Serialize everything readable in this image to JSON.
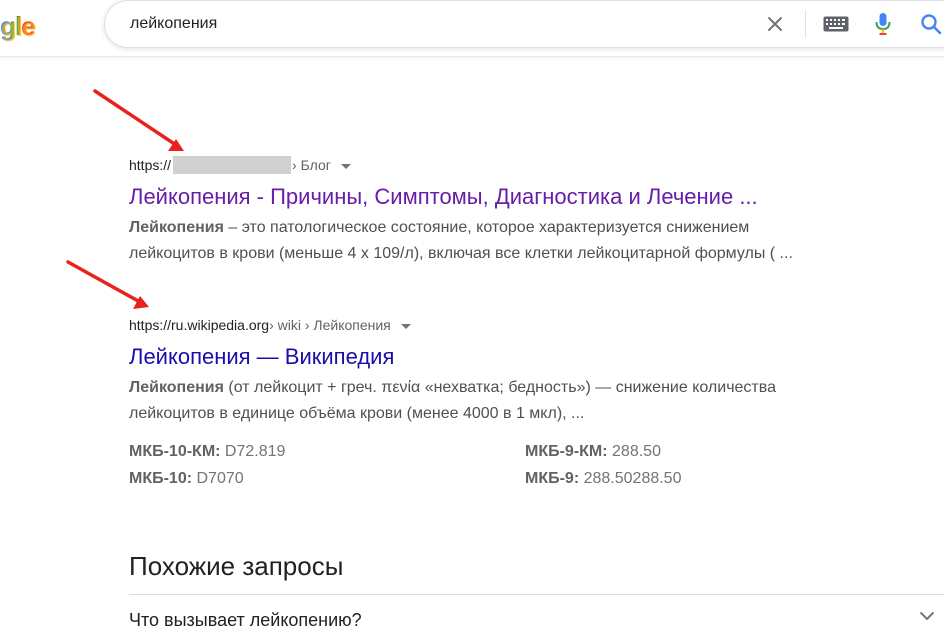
{
  "header": {
    "logo_fragment": "gle",
    "search": {
      "value": "лейкопения",
      "placeholder": ""
    }
  },
  "results": [
    {
      "url_prefix": "https://",
      "url_path": " › Блог",
      "title": "Лейкопения - Причины, Симптомы, Диагностика и Лечение ...",
      "snippet_bold": "Лейкопения",
      "snippet_line1": " – это патологическое состояние, которое характеризуется снижением",
      "snippet_line2": "лейкоцитов в крови (меньше 4 x 109/л), включая все клетки лейкоцитарной формулы ( ...",
      "visited": true
    },
    {
      "url_prefix": "https://ru.wikipedia.org",
      "url_path": " › wiki › Лейкопения",
      "title": "Лейкопения — Википедия",
      "snippet_bold": "Лейкопения",
      "snippet_line1": " (от лейкоцит + греч. πενία «нехватка; бедность») — снижение количества",
      "snippet_line2": "лейкоцитов в единице объёма крови (менее 4000 в 1 мкл), ...",
      "visited": false
    }
  ],
  "facts": [
    {
      "label": "МКБ-10-КМ:",
      "value": " D72.819"
    },
    {
      "label": "МКБ-9-КМ:",
      "value": " 288.50"
    },
    {
      "label": "МКБ-10:",
      "value": " D7070"
    },
    {
      "label": "МКБ-9:",
      "value": " 288.50288.50"
    }
  ],
  "related": {
    "title": "Похожие запросы",
    "items": [
      "Что вызывает лейкопению?"
    ]
  },
  "colors": {
    "visited_link": "#681da8",
    "link": "#1a0dab",
    "annotation_arrow": "#e8231f",
    "mic_blue": "#4285f4",
    "mic_red": "#ea4335"
  },
  "icons": {
    "clear": "close-icon",
    "keyboard": "keyboard-icon",
    "mic": "microphone-icon",
    "search": "search-icon",
    "caret": "caret-down-icon",
    "chevron": "chevron-down-icon"
  }
}
